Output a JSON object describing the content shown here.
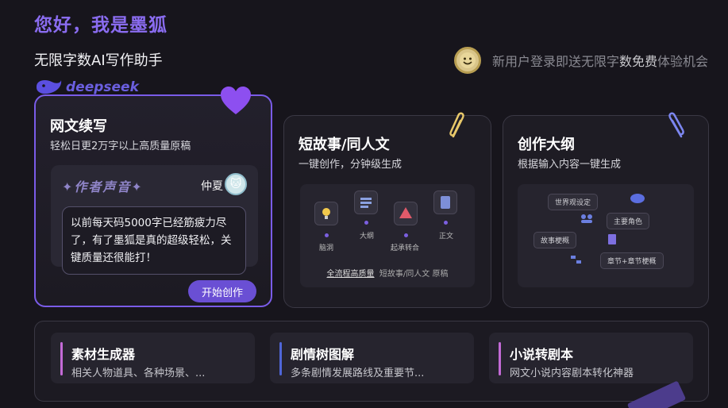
{
  "header": {
    "greeting": "您好，我是墨狐",
    "subtitle": "无限字数AI写作助手",
    "promo_pre": "新用户登录即送无限字",
    "promo_hl": "数免费",
    "promo_post": "体验机会"
  },
  "brand": {
    "deepseek": "deepseek"
  },
  "cards": {
    "main": {
      "title": "网文续写",
      "desc": "轻松日更2万字以上高质量原稿",
      "voice_title": "✦作者声音✦",
      "author": "仲夏",
      "quote": "以前每天码5000字已经筋疲力尽了，有了墨狐是真的超级轻松，关键质量还很能打！",
      "button": "开始创作"
    },
    "short": {
      "title": "短故事/同人文",
      "desc": "一键创作，分钟级生成",
      "nodes": [
        "脑洞",
        "大纲",
        "起承转合",
        "正文"
      ],
      "foot_u": "全流程高质量",
      "foot_rest": "短故事/同人文 原稿"
    },
    "outline": {
      "title": "创作大纲",
      "desc": "根据输入内容一键生成",
      "tags": [
        "世界观设定",
        "主要角色",
        "故事梗概",
        "章节+章节梗概"
      ]
    }
  },
  "tools": [
    {
      "title": "素材生成器",
      "desc": "相关人物道具、各种场景、...",
      "color": "#c36ad6"
    },
    {
      "title": "剧情树图解",
      "desc": "多条剧情发展路线及重要节...",
      "color": "#4f66d8"
    },
    {
      "title": "小说转剧本",
      "desc": "网文小说内容剧本转化神器",
      "color": "#c36ad6"
    }
  ],
  "colors": {
    "accent": "#7a5ce8",
    "button": "#6a4fd4",
    "greeting": "#8a6cf0"
  }
}
